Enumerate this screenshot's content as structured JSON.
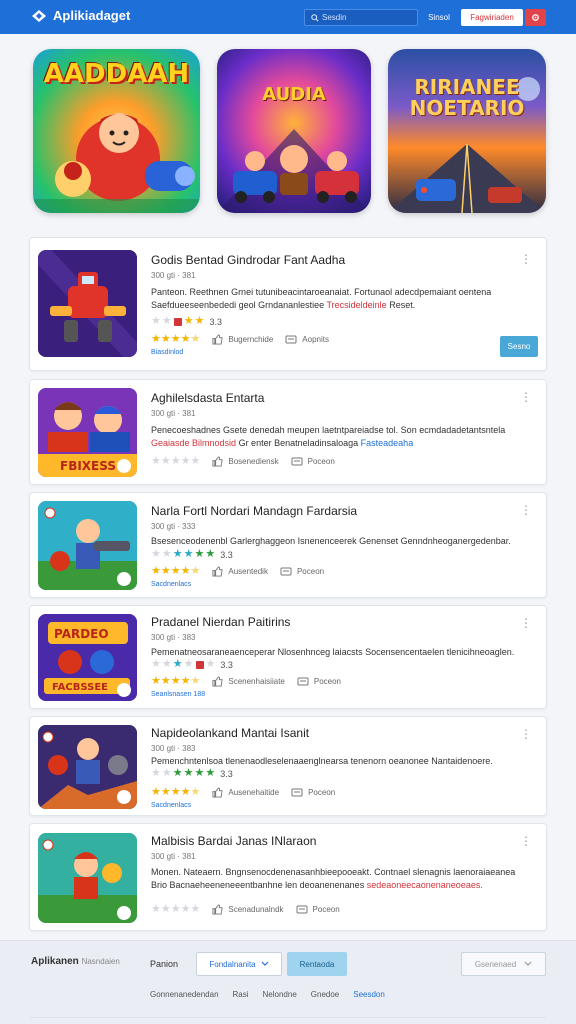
{
  "header": {
    "logo_text": "Aplikiadaget",
    "search_placeholder": "Sesdin",
    "link_label": "Sinsol",
    "signup_label": "Fagwiriaden",
    "colors": {
      "bar": "#1f6fd8",
      "accent": "#e2434a"
    }
  },
  "banners": [
    {
      "title": "AADDAAH"
    },
    {
      "title": "AUDIA"
    },
    {
      "title": "RIRIANEE NOETARIO"
    }
  ],
  "cards": [
    {
      "title": "Godis Bentad Gindrodar Fant Aadha",
      "meta": "300 gti · 381",
      "desc_a": "Panteon. Reethnen Grnei tutunibeacintaroeanaiat. Fortunaol adecdpemaiant oentena",
      "desc_b": "Saefdueeseenbededi geol Grndananlestiee ",
      "desc_hl": "Trecsideldeinle",
      "desc_c": " Reset.",
      "rating": "3.3",
      "stars": [
        1,
        1,
        1,
        1,
        0.5
      ],
      "action_a": "Bugernchide",
      "action_b": "Aopnits",
      "category": "Biasdinlod",
      "button": "Sesno",
      "more": "⋮"
    },
    {
      "title": "Aghilelsdasta Entarta",
      "meta": "300 gti · 381",
      "desc_a": "Penecoeshadnes Gsete denedah meupen laetntpareiadse tol. Son ecmdadadetantsntela",
      "desc_b": "",
      "desc_hl": "Geaiasde Bilmnodsid ",
      "desc_c": "Gr enter Benatneladinsaloaga ",
      "desc_hl2": "Fasteadeaha",
      "rating": "",
      "stars": [
        0,
        0,
        0,
        0,
        0
      ],
      "action_a": "Bosenediensk",
      "action_b": "Poceon",
      "category": "",
      "button": "",
      "more": "⋮"
    },
    {
      "title": "Narla Fortl Nordari Mandagn Fardarsia",
      "meta": "300 gti · 333",
      "desc_a": "Bsesenceodenenbl Garlerghaggeon Isnenenceerek Genenset Genndnheoganergedenbar.",
      "desc_b": "",
      "desc_hl": "",
      "desc_c": "",
      "rating": "3.3",
      "stars": [
        1,
        1,
        1,
        1,
        0.5
      ],
      "action_a": "Ausentedik",
      "action_b": "Poceon",
      "category": "Sacdnenlacs",
      "button": "",
      "more": "⋮"
    },
    {
      "title": "Pradanel Nierdan Paitirins",
      "meta": "300 gti · 383",
      "desc_a": "Pemenatneosaraneaenceperar Nlosenhnceg laiacsts Socensencentaelen tlenicihneoaglen.",
      "desc_b": "",
      "desc_hl": "",
      "desc_c": "",
      "rating": "3.3",
      "stars": [
        1,
        1,
        1,
        1,
        0.5
      ],
      "action_a": "Scenenhaisiiate",
      "action_b": "Poceon",
      "category": "Seanlsnasen 188",
      "button": "",
      "more": "⋮"
    },
    {
      "title": "Napideolankand Mantai Isanit",
      "meta": "300 gti · 383",
      "desc_a": "Pemenchntenlsoa tlenenaodleselenaaenglnearsa tenenorn oeanonee Nantaidenoere.",
      "desc_b": "",
      "desc_hl": "",
      "desc_c": "",
      "rating": "3.3",
      "stars": [
        1,
        1,
        1,
        1,
        0.5
      ],
      "action_a": "Ausenehaitide",
      "action_b": "Poceon",
      "category": "Sacdnenlacs",
      "button": "",
      "more": "⋮"
    },
    {
      "title": "Malbisis Bardai Janas INlaraon",
      "meta": "300 gti · 381",
      "desc_a": "Monen. Nateaern. Bngnsenocdenenasanhbieepooeakt. Contnael slenagnis laenoraiaeanea",
      "desc_b": "Brio Bacnaeheeneneeentbanhne len deoanenenanes",
      "desc_hl": "sedeaoneecaonenaneoeaes.",
      "desc_c": "",
      "rating": "",
      "stars": [
        0,
        0,
        0,
        0,
        0
      ],
      "action_a": "Scenadunalndk",
      "action_b": "Poceon",
      "category": "",
      "button": "",
      "more": "⋮"
    }
  ],
  "footer": {
    "brand": "Aplikanen",
    "brand_small": "Nasndaien",
    "filter_label": "Panion",
    "select_value": "Fondalnanita",
    "apply_label": "Rentaoda",
    "right_select": "Gsenenaed",
    "links": [
      "Gonnenanedendan",
      "Rasi",
      "Nelondne",
      "Gnedoe",
      "Seesdon"
    ]
  }
}
